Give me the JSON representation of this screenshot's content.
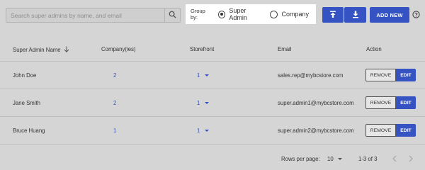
{
  "search": {
    "placeholder": "Search super admins by name, and email"
  },
  "group_by": {
    "label": "Group by:",
    "options": [
      {
        "label": "Super Admin",
        "selected": true
      },
      {
        "label": "Company",
        "selected": false
      }
    ]
  },
  "toolbar": {
    "add_new_label": "ADD NEW"
  },
  "icons": {
    "search": "search-icon",
    "upload": "upload-icon",
    "download": "download-icon",
    "help": "help-icon",
    "sort": "arrow-down-icon",
    "prev": "chevron-left-icon",
    "next": "chevron-right-icon"
  },
  "table": {
    "columns": [
      "Super Admin Name",
      "Company(ies)",
      "Storefront",
      "Email",
      "Action"
    ],
    "rows": [
      {
        "name": "John Doe",
        "companies": "2",
        "storefront": "1",
        "email": "sales.rep@mybcstore.com"
      },
      {
        "name": "Jane Smith",
        "companies": "2",
        "storefront": "1",
        "email": "super.admin1@mybcstore.com"
      },
      {
        "name": "Bruce Huang",
        "companies": "1",
        "storefront": "1",
        "email": "super.admin2@mybcstore.com"
      }
    ],
    "remove_label": "REMOVE",
    "edit_label": "EDIT"
  },
  "pagination": {
    "rows_per_page_label": "Rows per page:",
    "rows_per_page": "10",
    "range": "1-3 of 3"
  },
  "colors": {
    "accent": "#3553c3",
    "background": "#d5d5d5",
    "highlight": "#ffffff"
  }
}
